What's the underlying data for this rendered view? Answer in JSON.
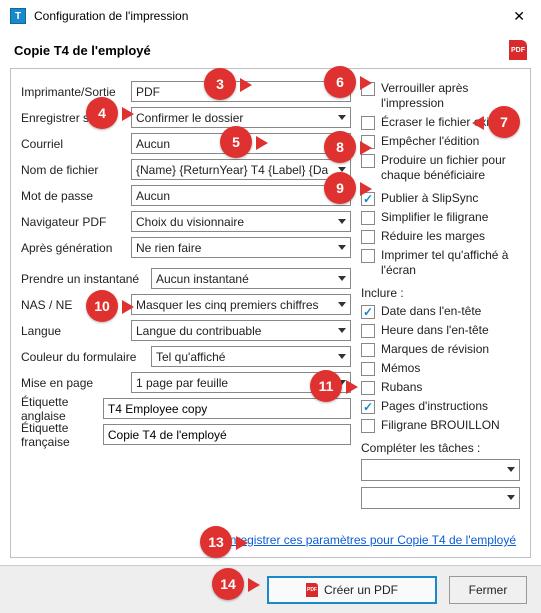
{
  "window": {
    "title": "Configuration de l'impression",
    "subtitle": "Copie T4 de l'employé"
  },
  "left": {
    "printer_label": "Imprimante/Sortie",
    "printer_value": "PDF",
    "saveas_label": "Enregistrer sous",
    "saveas_value": "Confirmer le dossier",
    "email_label": "Courriel",
    "email_value": "Aucun",
    "filename_label": "Nom de fichier",
    "filename_value": "{Name} {ReturnYear} T4 {Label} {Da",
    "password_label": "Mot de passe",
    "password_value": "Aucun",
    "viewer_label": "Navigateur PDF",
    "viewer_value": "Choix du visionnaire",
    "aftergen_label": "Après génération",
    "aftergen_value": "Ne rien faire",
    "snapshot_label": "Prendre un instantané",
    "snapshot_value": "Aucun instantané",
    "sin_label": "NAS / NE",
    "sin_value": "Masquer les cinq premiers chiffres",
    "lang_label": "Langue",
    "lang_value": "Langue du contribuable",
    "formcolor_label": "Couleur du formulaire",
    "formcolor_value": "Tel qu'affiché",
    "layout_label": "Mise en page",
    "layout_value": "1 page par feuille",
    "label_en_label": "Étiquette anglaise",
    "label_en_value": "T4 Employee copy",
    "label_fr_label": "Étiquette française",
    "label_fr_value": "Copie T4 de l'employé"
  },
  "right": {
    "lock": "Verrouiller après l'impression",
    "overwrite": "Écraser le fichier existant",
    "noedit": "Empêcher l'édition",
    "perben": "Produire un fichier pour chaque bénéficiaire",
    "slipsync": "Publier à SlipSync",
    "simplify": "Simplifier le filigrane",
    "margins": "Réduire les marges",
    "asis": "Imprimer tel qu'affiché à l'écran",
    "include_title": "Inclure :",
    "inc_datehdr": "Date dans l'en-tête",
    "inc_timehdr": "Heure dans l'en-tête",
    "inc_revmarks": "Marques de révision",
    "inc_memos": "Mémos",
    "inc_ribbons": "Rubans",
    "inc_instr": "Pages d'instructions",
    "inc_draft": "Filigrane BROUILLON",
    "tasks_title": "Compléter les tâches :"
  },
  "link": "Enregistrer ces paramètres pour Copie T4 de l'employé",
  "footer": {
    "create": "Créer un PDF",
    "close": "Fermer"
  },
  "callouts": {
    "c3": "3",
    "c4": "4",
    "c5": "5",
    "c6": "6",
    "c7": "7",
    "c8": "8",
    "c9": "9",
    "c10": "10",
    "c11": "11",
    "c13": "13",
    "c14": "14"
  },
  "checks": {
    "slipsync": true,
    "inc_datehdr": true,
    "inc_instr": true
  }
}
